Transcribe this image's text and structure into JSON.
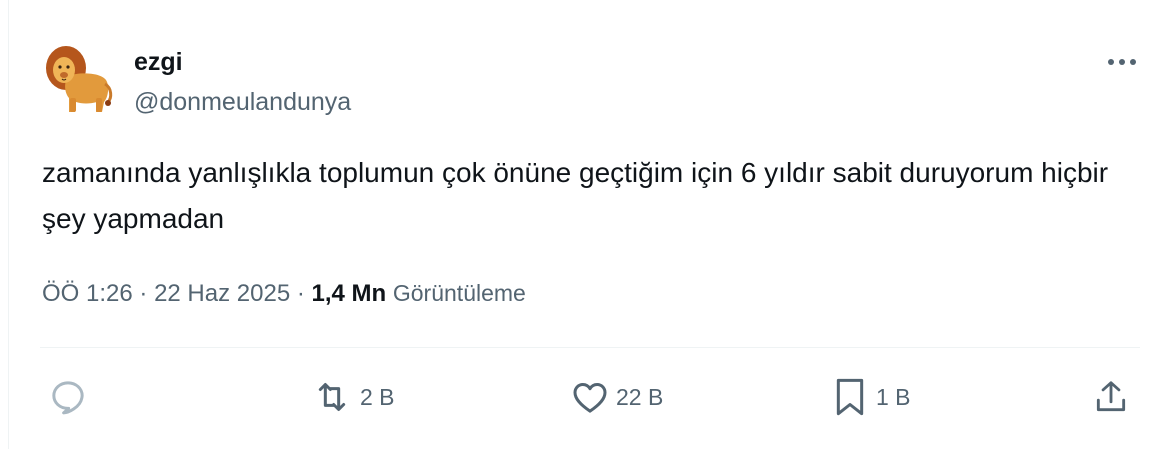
{
  "tweet": {
    "author": {
      "name": "ezgi",
      "handle": "@donmeulandunya",
      "avatar_icon": "lion-emoji-avatar"
    },
    "text": "zamanında yanlışlıkla toplumun çok önüne geçtiğim için 6 yıldır sabit duruyorum hiçbir şey yapmadan",
    "time": "ÖÖ 1:26",
    "separator": "·",
    "date": "22 Haz 2025",
    "views_count": "1,4 Mn",
    "views_label": "Görüntüleme"
  },
  "actions": {
    "reply": {
      "icon": "reply-icon",
      "count": ""
    },
    "retweet": {
      "icon": "retweet-icon",
      "count": "2 B"
    },
    "like": {
      "icon": "heart-icon",
      "count": "22 B"
    },
    "bookmark": {
      "icon": "bookmark-icon",
      "count": "1 B"
    },
    "share": {
      "icon": "share-icon",
      "count": ""
    }
  },
  "colors": {
    "text_primary": "#0f1419",
    "text_secondary": "#536471",
    "icon_gray": "#536471",
    "reply_icon_light": "#aab8c2",
    "divider": "#eff3f4"
  }
}
